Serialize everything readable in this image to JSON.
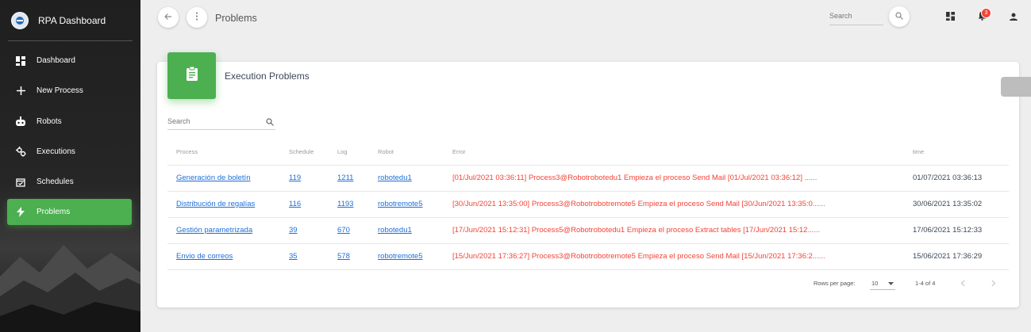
{
  "app": {
    "title": "RPA Dashboard"
  },
  "sidebar": {
    "items": [
      {
        "label": "Dashboard",
        "icon": "dashboard-icon"
      },
      {
        "label": "New Process",
        "icon": "plus-icon"
      },
      {
        "label": "Robots",
        "icon": "robot-icon"
      },
      {
        "label": "Executions",
        "icon": "gears-icon"
      },
      {
        "label": "Schedules",
        "icon": "calendar-icon"
      },
      {
        "label": "Problems",
        "icon": "bolt-icon",
        "active": true
      }
    ]
  },
  "topbar": {
    "title": "Problems",
    "search_placeholder": "Search",
    "notification_count": "3"
  },
  "card": {
    "title": "Execution Problems",
    "icon": "clipboard-icon",
    "search_placeholder": "Search",
    "columns": [
      "Process",
      "Schedule",
      "Log",
      "Robot",
      "Error",
      "time"
    ],
    "rows": [
      {
        "process": "Generación de boletín",
        "schedule": "119",
        "log": "1211",
        "robot": "robotedu1",
        "error": "[01/Jul/2021 03:36:11] Process3@Robotrobotedu1 Empieza el proceso Send Mail [01/Jul/2021 03:36:12] ......",
        "time": "01/07/2021 03:36:13"
      },
      {
        "process": "Distribución de regalías",
        "schedule": "116",
        "log": "1193",
        "robot": "robotremote5",
        "error": "[30/Jun/2021 13:35:00] Process3@Robotrobotremote5 Empieza el proceso Send Mail [30/Jun/2021 13:35:0......",
        "time": "30/06/2021 13:35:02"
      },
      {
        "process": "Gestión parametrizada",
        "schedule": "39",
        "log": "670",
        "robot": "robotedu1",
        "error": "[17/Jun/2021 15:12:31] Process5@Robotrobotedu1 Empieza el proceso Extract tables [17/Jun/2021 15:12......",
        "time": "17/06/2021 15:12:33"
      },
      {
        "process": "Envio de correos",
        "schedule": "35",
        "log": "578",
        "robot": "robotremote5",
        "error": "[15/Jun/2021 17:36:27] Process3@Robotrobotremote5 Empieza el proceso Send Mail [15/Jun/2021 17:36:2......",
        "time": "15/06/2021 17:36:29"
      }
    ],
    "pagination": {
      "rows_per_page_label": "Rows per page:",
      "rows_per_page": "10",
      "range": "1-4 of 4"
    }
  },
  "colors": {
    "accent": "#4caf50",
    "error": "#f44336",
    "link": "#1e6fd9",
    "badge": "#f44336"
  }
}
